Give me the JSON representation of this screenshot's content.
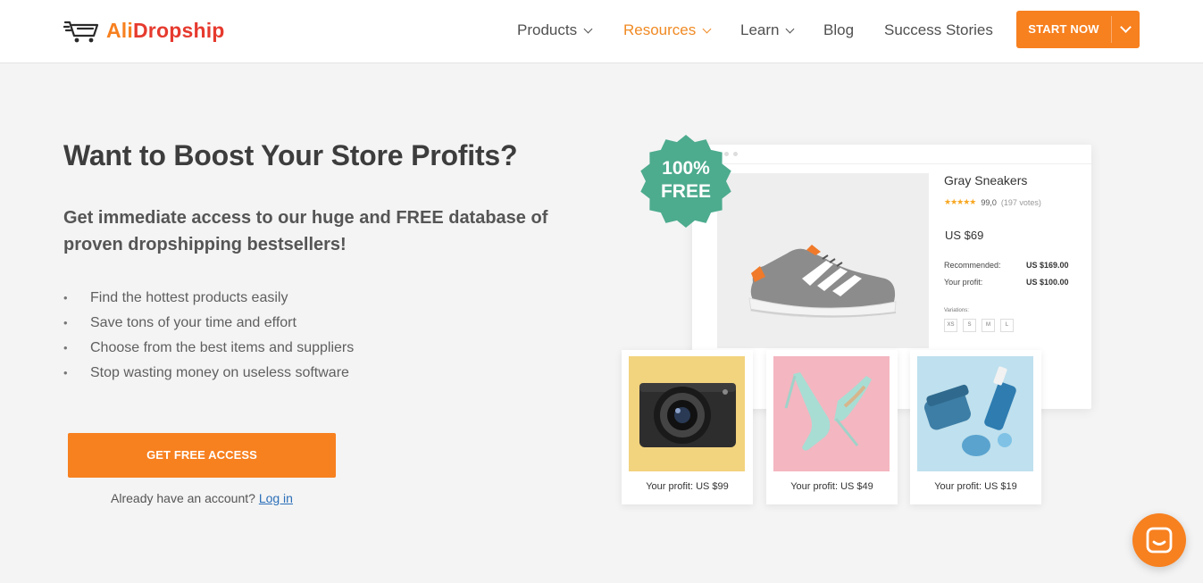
{
  "brand": {
    "name_part1": "Ali",
    "name_part2": "Dropship",
    "colors": {
      "accent": "#f7801f",
      "red": "#e63a2e",
      "badge": "#4dab8e",
      "link": "#2b6fb8"
    }
  },
  "nav": {
    "items": [
      {
        "label": "Products",
        "has_dropdown": true,
        "active": false
      },
      {
        "label": "Resources",
        "has_dropdown": true,
        "active": true
      },
      {
        "label": "Learn",
        "has_dropdown": true,
        "active": false
      },
      {
        "label": "Blog",
        "has_dropdown": false,
        "active": false
      },
      {
        "label": "Success Stories",
        "has_dropdown": false,
        "active": false
      }
    ],
    "cta_label": "START NOW"
  },
  "hero": {
    "title": "Want to Boost Your Store Profits?",
    "subtitle": "Get immediate access to our huge and FREE database of proven dropshipping bestsellers!",
    "bullets": [
      "Find the hottest products easily",
      "Save tons of your time and effort",
      "Choose from the best items and suppliers",
      "Stop wasting money on useless software"
    ],
    "cta_label": "GET FREE ACCESS",
    "login_prompt": "Already have an account?",
    "login_link": "Log in"
  },
  "mockup": {
    "badge_line1": "100%",
    "badge_line2": "FREE",
    "product_name": "Gray Sneakers",
    "stars": "★★★★★",
    "rating": "99,0",
    "votes": "(197 votes)",
    "price": "US $69",
    "recommended_label": "Recommended:",
    "recommended_value": "US $169.00",
    "profit_label": "Your profit:",
    "profit_value": "US $100.00",
    "variations_label": "Variations:",
    "sizes": [
      "XS",
      "S",
      "M",
      "L"
    ],
    "cards": [
      {
        "caption": "Your profit: US $99",
        "icon": "camera-icon"
      },
      {
        "caption": "Your profit: US $49",
        "icon": "heels-icon"
      },
      {
        "caption": "Your profit: US $19",
        "icon": "cosmetics-icon"
      }
    ]
  },
  "chat": {
    "icon": "chat-icon"
  }
}
